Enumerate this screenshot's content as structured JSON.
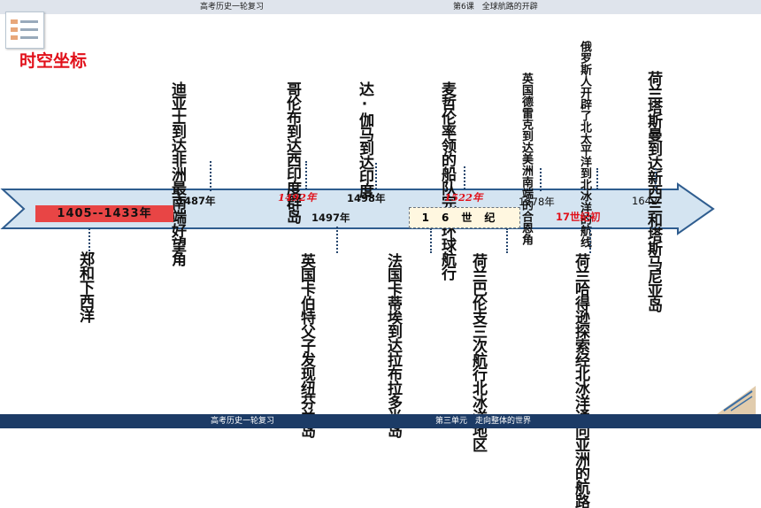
{
  "header": {
    "left": "高考历史一轮复习",
    "right": "第6课　全球航路的开辟"
  },
  "section_title": "时空坐标",
  "timeline": {
    "top_events": [
      {
        "id": "dias",
        "text": "迪亚士到达非洲最南端好望角",
        "date": "1487年"
      },
      {
        "id": "columbus",
        "text": "哥伦布到达西印度群岛",
        "date": "1492年"
      },
      {
        "id": "gama",
        "text": "达·伽马到达印度",
        "date": "1498年"
      },
      {
        "id": "magellan",
        "text": "麦哲伦率领的船队完成环球航行",
        "date": "1522年"
      },
      {
        "id": "drake",
        "text": "英国德雷克到达美洲南端的合恩角",
        "date": "1578年"
      },
      {
        "id": "russia",
        "text": "俄罗斯人开辟了北太平洋到北冰洋的航线",
        "date": ""
      },
      {
        "id": "tasman",
        "text": "荷兰塔斯曼到达新西兰和塔斯马尼亚岛",
        "date": "1642"
      }
    ],
    "bottom_events": [
      {
        "id": "zhenghe",
        "text": "郑和下西洋",
        "date": "1405--1433年"
      },
      {
        "id": "cabot",
        "text": "英国卡伯特父子发现纽芬兰岛",
        "date": "1497年"
      },
      {
        "id": "cartier",
        "text": "法国卡蒂埃到达拉布拉多半岛",
        "date": "16世纪"
      },
      {
        "id": "barents",
        "text": "荷兰巴伦支三次航行北冰洋地区",
        "date": ""
      },
      {
        "id": "hudson",
        "text": "荷兰哈得逊探索经北冰洋通向亚洲的航路",
        "date": "17世纪初"
      }
    ]
  },
  "footer": {
    "left": "高考历史一轮复习",
    "right": "第三单元　走向整体的世界"
  },
  "colors": {
    "arrow_fill": "#d4e4f1",
    "arrow_stroke": "#2f5d8f",
    "accent_red": "#e1101a",
    "footer_bg": "#1c3b66"
  }
}
